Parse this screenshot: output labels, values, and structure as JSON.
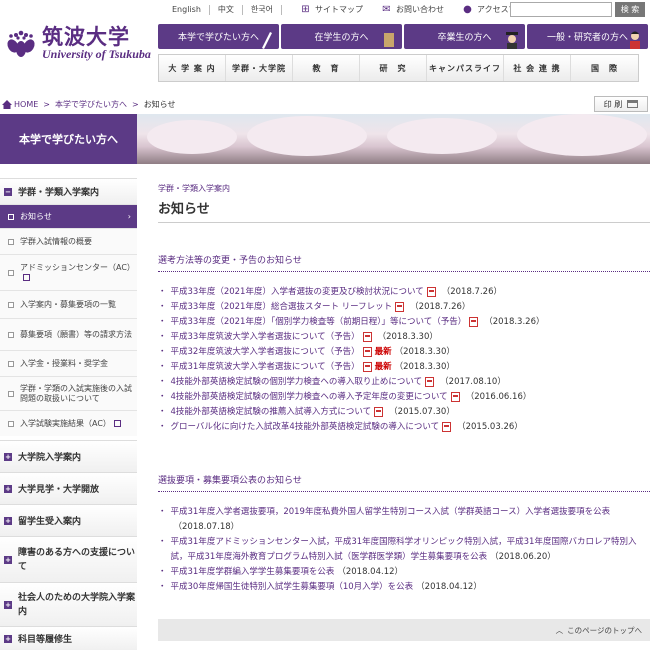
{
  "header": {
    "logo_jp": "筑波大学",
    "logo_en": "University of Tsukuba",
    "languages": [
      "English",
      "中文",
      "한국어"
    ],
    "util_links": [
      {
        "label": "サイトマップ",
        "icon": "sitemap-icon"
      },
      {
        "label": "お問い合わせ",
        "icon": "mail-icon"
      },
      {
        "label": "アクセスマップ",
        "icon": "map-pin-icon"
      }
    ],
    "search_button": "検 索",
    "top_nav": [
      "本学で学びたい方へ",
      "在学生の方へ",
      "卒業生の方へ",
      "一般・研究者の方へ"
    ],
    "main_nav": [
      "大 学 案 内",
      "学群・大学院",
      "教　育",
      "研　究",
      "キャンパスライフ",
      "社 会 連 携",
      "国　際"
    ]
  },
  "breadcrumb": {
    "home": "HOME",
    "parent": "本学で学びたい方へ",
    "current": "お知らせ"
  },
  "print_label": "印 刷",
  "banner_title": "本学で学びたい方へ",
  "sidebar": {
    "sec1": "学群・学類入学案内",
    "items": [
      "お知らせ",
      "学群入試情報の概要",
      "アドミッションセンター（AC）",
      "入学案内・募集要項の一覧",
      "募集要項（願書）等の請求方法",
      "入学金・授業料・奨学金",
      "学群・学類の入試実施後の入試問題の取扱いについて",
      "入学試験実施結果（AC）"
    ],
    "sections": [
      "大学院入学案内",
      "大学見学・大学開放",
      "留学生受入案内",
      "障害のある方への支援について",
      "社会人のための大学院入学案内",
      "科目等履修生"
    ]
  },
  "content": {
    "category": "学群・学類入学案内",
    "title": "お知らせ",
    "section1": {
      "heading": "選考方法等の変更・予告のお知らせ",
      "items": [
        {
          "text": "平成33年度（2021年度）入学者選抜の変更及び検討状況について",
          "new": "",
          "date": "（2018.7.26）"
        },
        {
          "text": "平成33年度（2021年度）総合選抜スタート リーフレット",
          "new": "",
          "date": "（2018.7.26）"
        },
        {
          "text": "平成33年度（2021年度）「個別学力検査等（前期日程）」等について（予告）",
          "new": "",
          "date": "（2018.3.26）"
        },
        {
          "text": "平成33年度筑波大学入学者選抜について（予告）",
          "new": "",
          "date": "（2018.3.30）"
        },
        {
          "text": "平成32年度筑波大学入学者選抜について（予告）",
          "new": "最新",
          "date": "（2018.3.30）"
        },
        {
          "text": "平成31年度筑波大学入学者選抜について（予告）",
          "new": "最新",
          "date": "（2018.3.30）"
        },
        {
          "text": "4技能外部英語検定試験の個別学力検査への導入取り止めについて",
          "new": "",
          "date": "（2017.08.10）"
        },
        {
          "text": "4技能外部英語検定試験の個別学力検査への導入予定年度の変更について",
          "new": "",
          "date": "（2016.06.16）"
        },
        {
          "text": "4技能外部英語検定試験の推薦入試導入方式について",
          "new": "",
          "date": "（2015.07.30）"
        },
        {
          "text": "グローバル化に向けた入試改革4技能外部英語検定試験の導入について",
          "new": "",
          "date": "（2015.03.26）"
        }
      ]
    },
    "section2": {
      "heading": "選抜要項・募集要項公表のお知らせ",
      "items": [
        {
          "text": "平成31年度入学者選抜要項，2019年度私費外国人留学生特別コース入試（学群英語コース）入学者選抜要項を公表",
          "date": "（2018.07.18）"
        },
        {
          "text": "平成31年度アドミッションセンター入試，平成31年度国際科学オリンピック特別入試，平成31年度国際バカロレア特別入試，平成31年度海外教育プログラム特別入試（医学群医学類）学生募集要項を公表",
          "date": "（2018.06.20）"
        },
        {
          "text": "平成31年度学群編入学学生募集要項を公表",
          "date": "（2018.04.12）"
        },
        {
          "text": "平成30年度帰国生徒特別入試学生募集要項（10月入学）を公表",
          "date": "（2018.04.12）"
        }
      ]
    },
    "to_top": "このページのトップへ"
  }
}
